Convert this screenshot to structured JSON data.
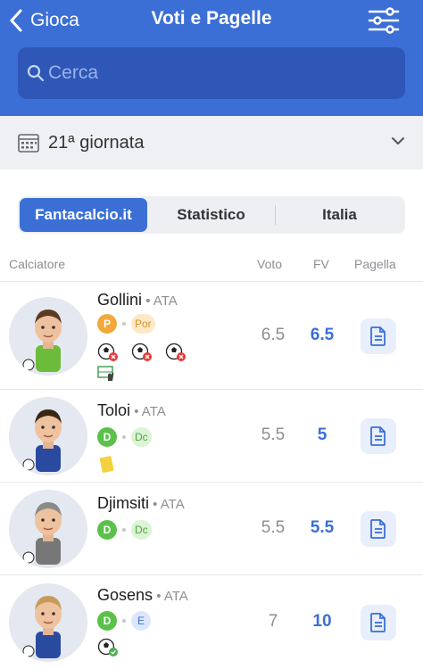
{
  "header": {
    "back_label": "Gioca",
    "title": "Voti e Pagelle",
    "search_placeholder": "Cerca",
    "bg_color": "#3b6fd6"
  },
  "round": {
    "label": "21ª giornata"
  },
  "tabs": [
    {
      "label": "Fantacalcio.it",
      "active": true
    },
    {
      "label": "Statistico",
      "active": false
    },
    {
      "label": "Italia",
      "active": false
    }
  ],
  "columns": {
    "player": "Calciatore",
    "voto": "Voto",
    "fv": "FV",
    "pagella": "Pagella"
  },
  "players": [
    {
      "name": "Gollini",
      "team": "ATA",
      "role": "P",
      "role_color": "#f2a93b",
      "subrole": "Por",
      "subrole_bg": "#fde9c8",
      "subrole_color": "#d9902a",
      "events": [
        "goal-conceded-icon",
        "goal-conceded-icon",
        "goal-conceded-icon",
        "goalkeeper-glove-icon"
      ],
      "voto": "6.5",
      "fv": "6.5"
    },
    {
      "name": "Toloi",
      "team": "ATA",
      "role": "D",
      "role_color": "#5cc14a",
      "subrole": "Dc",
      "subrole_bg": "#dcf3d5",
      "subrole_color": "#4ea83f",
      "events": [
        "yellow-card-icon"
      ],
      "voto": "5.5",
      "fv": "5"
    },
    {
      "name": "Djimsiti",
      "team": "ATA",
      "role": "D",
      "role_color": "#5cc14a",
      "subrole": "Dc",
      "subrole_bg": "#dcf3d5",
      "subrole_color": "#4ea83f",
      "events": [],
      "voto": "5.5",
      "fv": "5.5"
    },
    {
      "name": "Gosens",
      "team": "ATA",
      "role": "D",
      "role_color": "#5cc14a",
      "subrole": "E",
      "subrole_bg": "#dde7fa",
      "subrole_color": "#3b6fd6",
      "events": [
        "goal-scored-icon"
      ],
      "voto": "7",
      "fv": "10"
    }
  ]
}
